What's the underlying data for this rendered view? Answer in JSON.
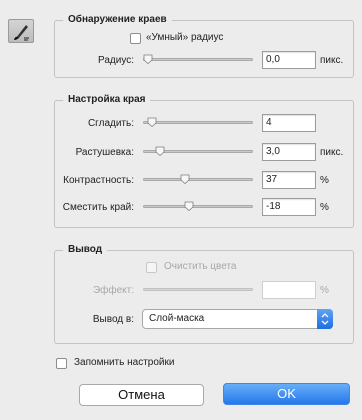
{
  "edge_detection": {
    "title": "Обнаружение краев",
    "smart_radius_label": "«Умный» радиус",
    "radius": {
      "label": "Радиус:",
      "value": "0,0",
      "unit": "пикс.",
      "level": 0.0
    }
  },
  "edge_adjust": {
    "title": "Настройка края",
    "smooth": {
      "label": "Сгладить:",
      "value": "4",
      "unit": "",
      "level": 0.04
    },
    "feather": {
      "label": "Растушевка:",
      "value": "3,0",
      "unit": "пикс.",
      "level": 0.12
    },
    "contrast": {
      "label": "Контрастность:",
      "value": "37",
      "unit": "%",
      "level": 0.37
    },
    "shift_edge": {
      "label": "Сместить край:",
      "value": "-18",
      "unit": "%",
      "level": 0.41
    }
  },
  "output": {
    "title": "Вывод",
    "decontaminate_label": "Очистить цвета",
    "amount": {
      "label": "Эффект:",
      "value": "",
      "unit": "%"
    },
    "output_to": {
      "label": "Вывод в:",
      "selected": "Слой-маска"
    }
  },
  "remember_label": "Запомнить настройки",
  "buttons": {
    "cancel": "Отмена",
    "ok": "OK"
  },
  "colors": {
    "accent": "#2478ea",
    "background": "#ececec"
  },
  "icons": {
    "tool": "refine-brush-icon",
    "select": "chevron-updown-icon"
  }
}
